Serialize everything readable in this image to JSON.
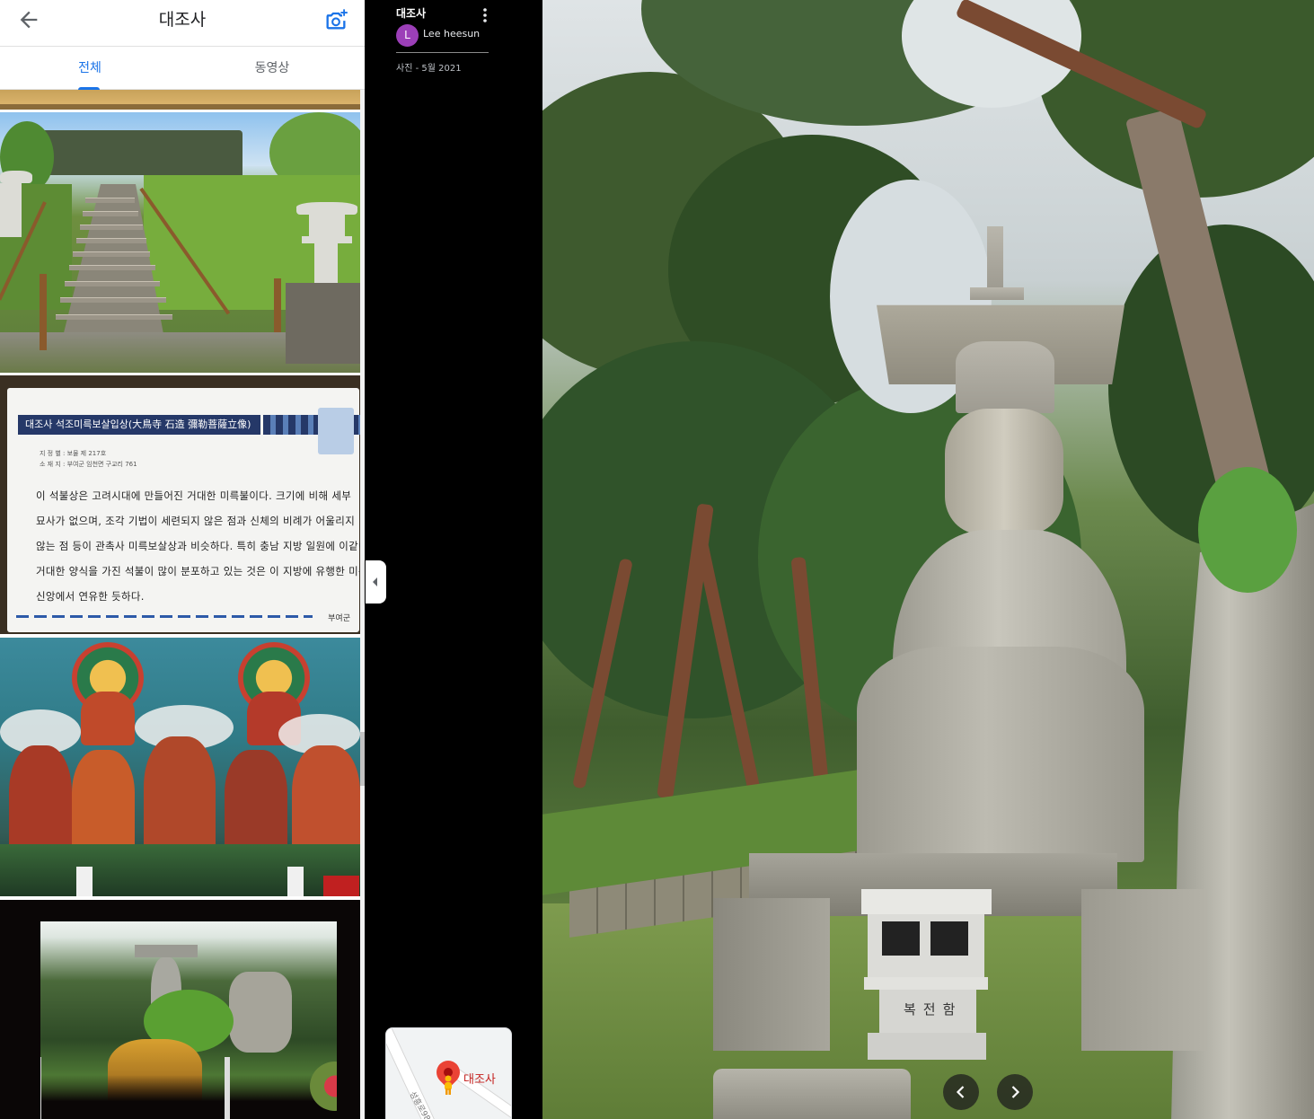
{
  "header": {
    "title": "대조사"
  },
  "tabs": [
    {
      "label": "전체",
      "active": true
    },
    {
      "label": "동영상",
      "active": false
    }
  ],
  "sign": {
    "heading": "대조사 석조미륵보살입상(大鳥寺 石造 彌勒菩薩立像)",
    "meta": [
      "지 정 별 :   보물 제 217호",
      "소 재 지 :   부여군 임천면 구교리 761"
    ],
    "lines": [
      "이 석불상은 고려시대에 만들어진 거대한 미륵불이다. 크기에 비해 세부",
      "묘사가 없으며, 조각 기법이 세련되지 않은 점과 신체의 비례가 어울리지",
      "않는 점 등이 관촉사 미륵보살상과 비슷하다. 특히 충남 지방 일원에 이같이",
      "거대한 양식을 가진 석불이 많이 분포하고 있는 것은 이 지방에 유행한 미륵",
      "신앙에서 연유한 듯하다."
    ],
    "footer": "부여군"
  },
  "info": {
    "title": "대조사",
    "avatar_letter": "L",
    "author": "Lee heesun",
    "date": "사진 - 5월 2021"
  },
  "minimap": {
    "place_label": "대조사",
    "road_label": "성흥로98"
  },
  "photo": {
    "plaque": "복전함"
  },
  "colors": {
    "accent": "#1a73e8",
    "avatar": "#9c3fb8",
    "pin": "#ea4335"
  }
}
